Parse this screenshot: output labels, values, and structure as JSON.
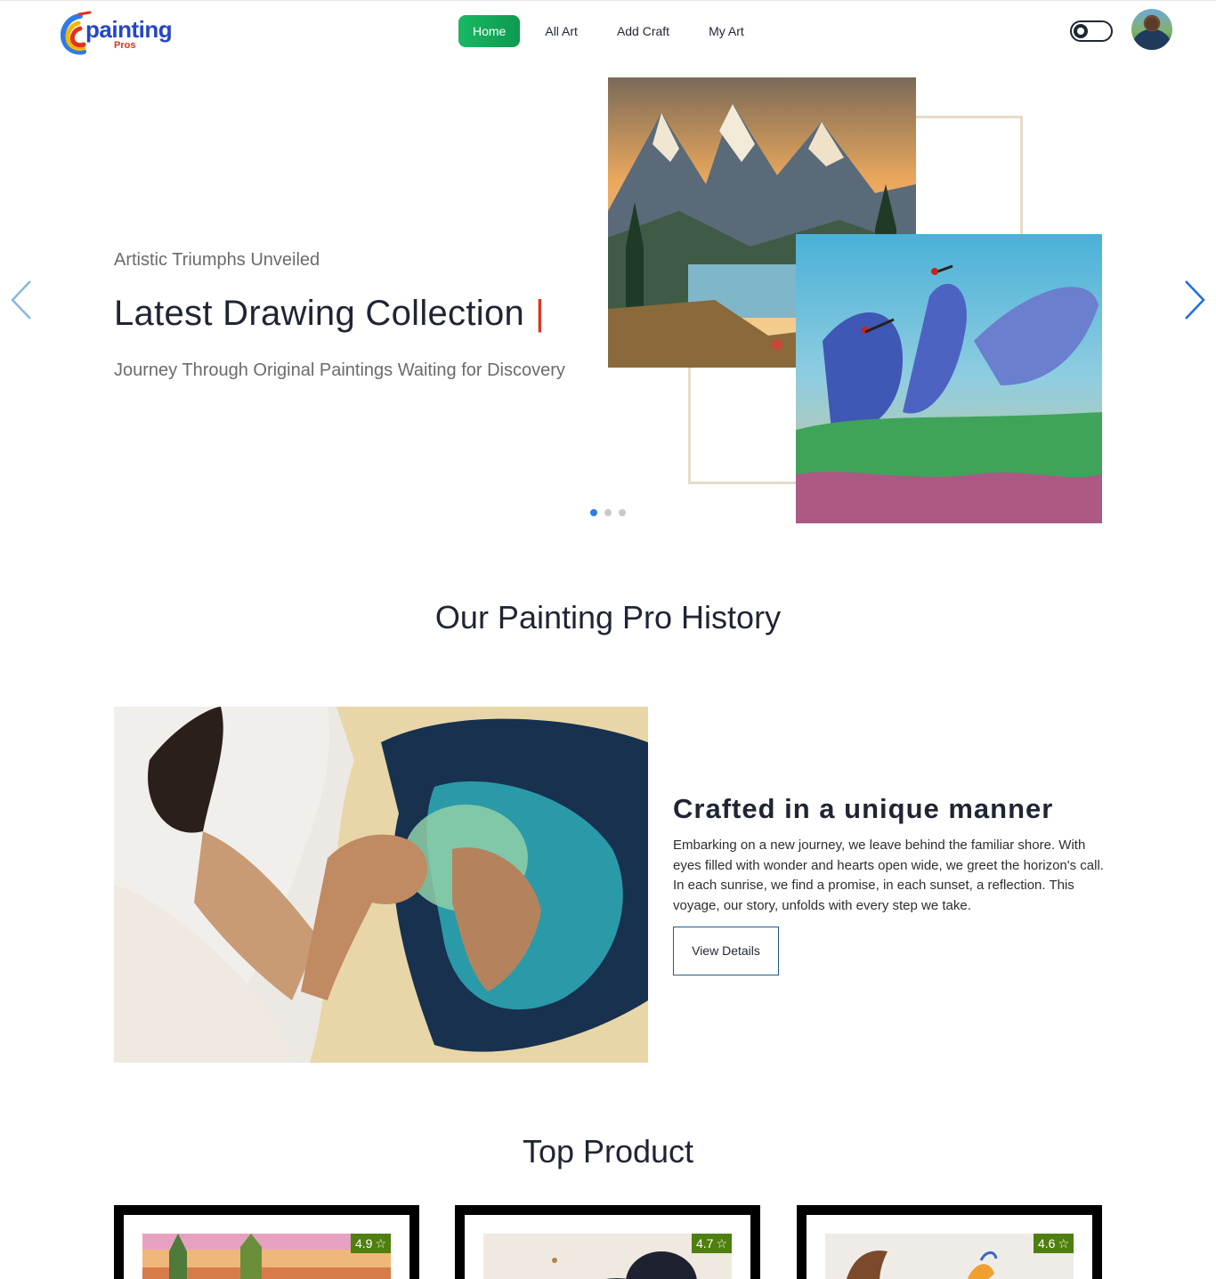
{
  "brand": {
    "name": "painting",
    "tagline": "Pros",
    "primary_color": "#2447c4",
    "accent_color": "#e0321c"
  },
  "nav": {
    "items": [
      {
        "label": "Home",
        "active": true
      },
      {
        "label": "All Art",
        "active": false
      },
      {
        "label": "Add Craft",
        "active": false
      },
      {
        "label": "My Art",
        "active": false
      }
    ],
    "active_color": "#18b864"
  },
  "theme_toggle": {
    "icon": "sun-icon",
    "state": "light"
  },
  "user": {
    "avatar": "user-avatar"
  },
  "hero": {
    "kicker": "Artistic Triumphs Unveiled",
    "title": "Latest Drawing Collection",
    "cursor": "|",
    "subtitle": "Journey Through Original Paintings Waiting for Discovery",
    "slides_count": 3,
    "active_slide": 1,
    "prev_icon": "chevron-left-icon",
    "next_icon": "chevron-right-icon"
  },
  "history": {
    "section_title": "Our Painting Pro History",
    "heading": "Crafted in a unique manner",
    "text": "Embarking on a new journey, we leave behind the familiar shore. With eyes filled with wonder and hearts open wide, we greet the horizon's call. In each sunrise, we find a promise, in each sunset, a reflection. This voyage, our story, unfolds with every step we take.",
    "button_label": "View Details"
  },
  "products": {
    "section_title": "Top Product",
    "items": [
      {
        "rating": "4.9",
        "star_icon": "star-icon",
        "rating_color": "#4f7f0e"
      },
      {
        "rating": "4.7",
        "star_icon": "star-icon",
        "rating_color": "#4f7f0e"
      },
      {
        "rating": "4.6",
        "star_icon": "star-icon",
        "rating_color": "#4f7f0e"
      }
    ]
  }
}
